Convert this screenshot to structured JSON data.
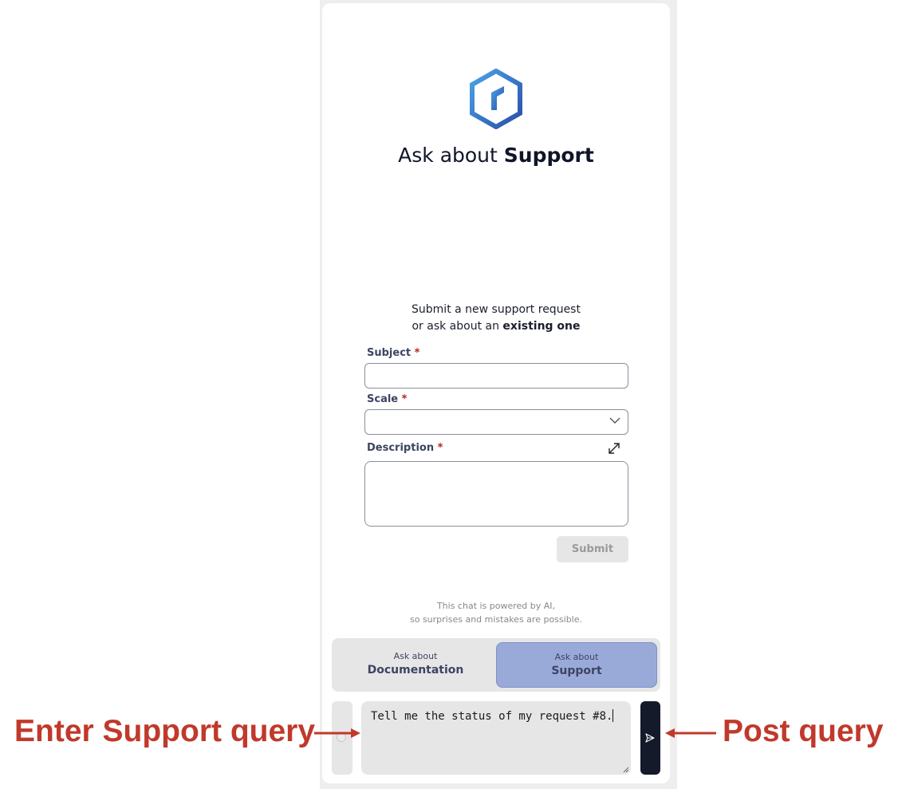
{
  "header": {
    "title_prefix": "Ask about ",
    "title_emphasis": "Support",
    "logo_icon": "hexagon-logo-icon"
  },
  "form": {
    "intro_line1": "Submit a new support request",
    "intro_line2_prefix": "or ask about an ",
    "intro_line2_emphasis": "existing one",
    "subject_label": "Subject",
    "scale_label": "Scale",
    "description_label": "Description",
    "required_mark": "*",
    "subject_value": "",
    "scale_value": "",
    "description_value": "",
    "submit_label": "Submit"
  },
  "disclaimer": {
    "line1": "This chat is powered by AI,",
    "line2": "so surprises and mistakes are possible."
  },
  "modes": [
    {
      "small": "Ask about",
      "big": "Documentation",
      "selected": false
    },
    {
      "small": "Ask about",
      "big": "Support",
      "selected": true
    }
  ],
  "query": {
    "value": "Tell me the status of my request #8."
  },
  "annotations": {
    "enter_label": "Enter Support query",
    "post_label": "Post query",
    "color": "#c0392b"
  },
  "colors": {
    "selected_mode": "#9aaad8",
    "send_button": "#141a2a",
    "required": "#b3261e"
  }
}
